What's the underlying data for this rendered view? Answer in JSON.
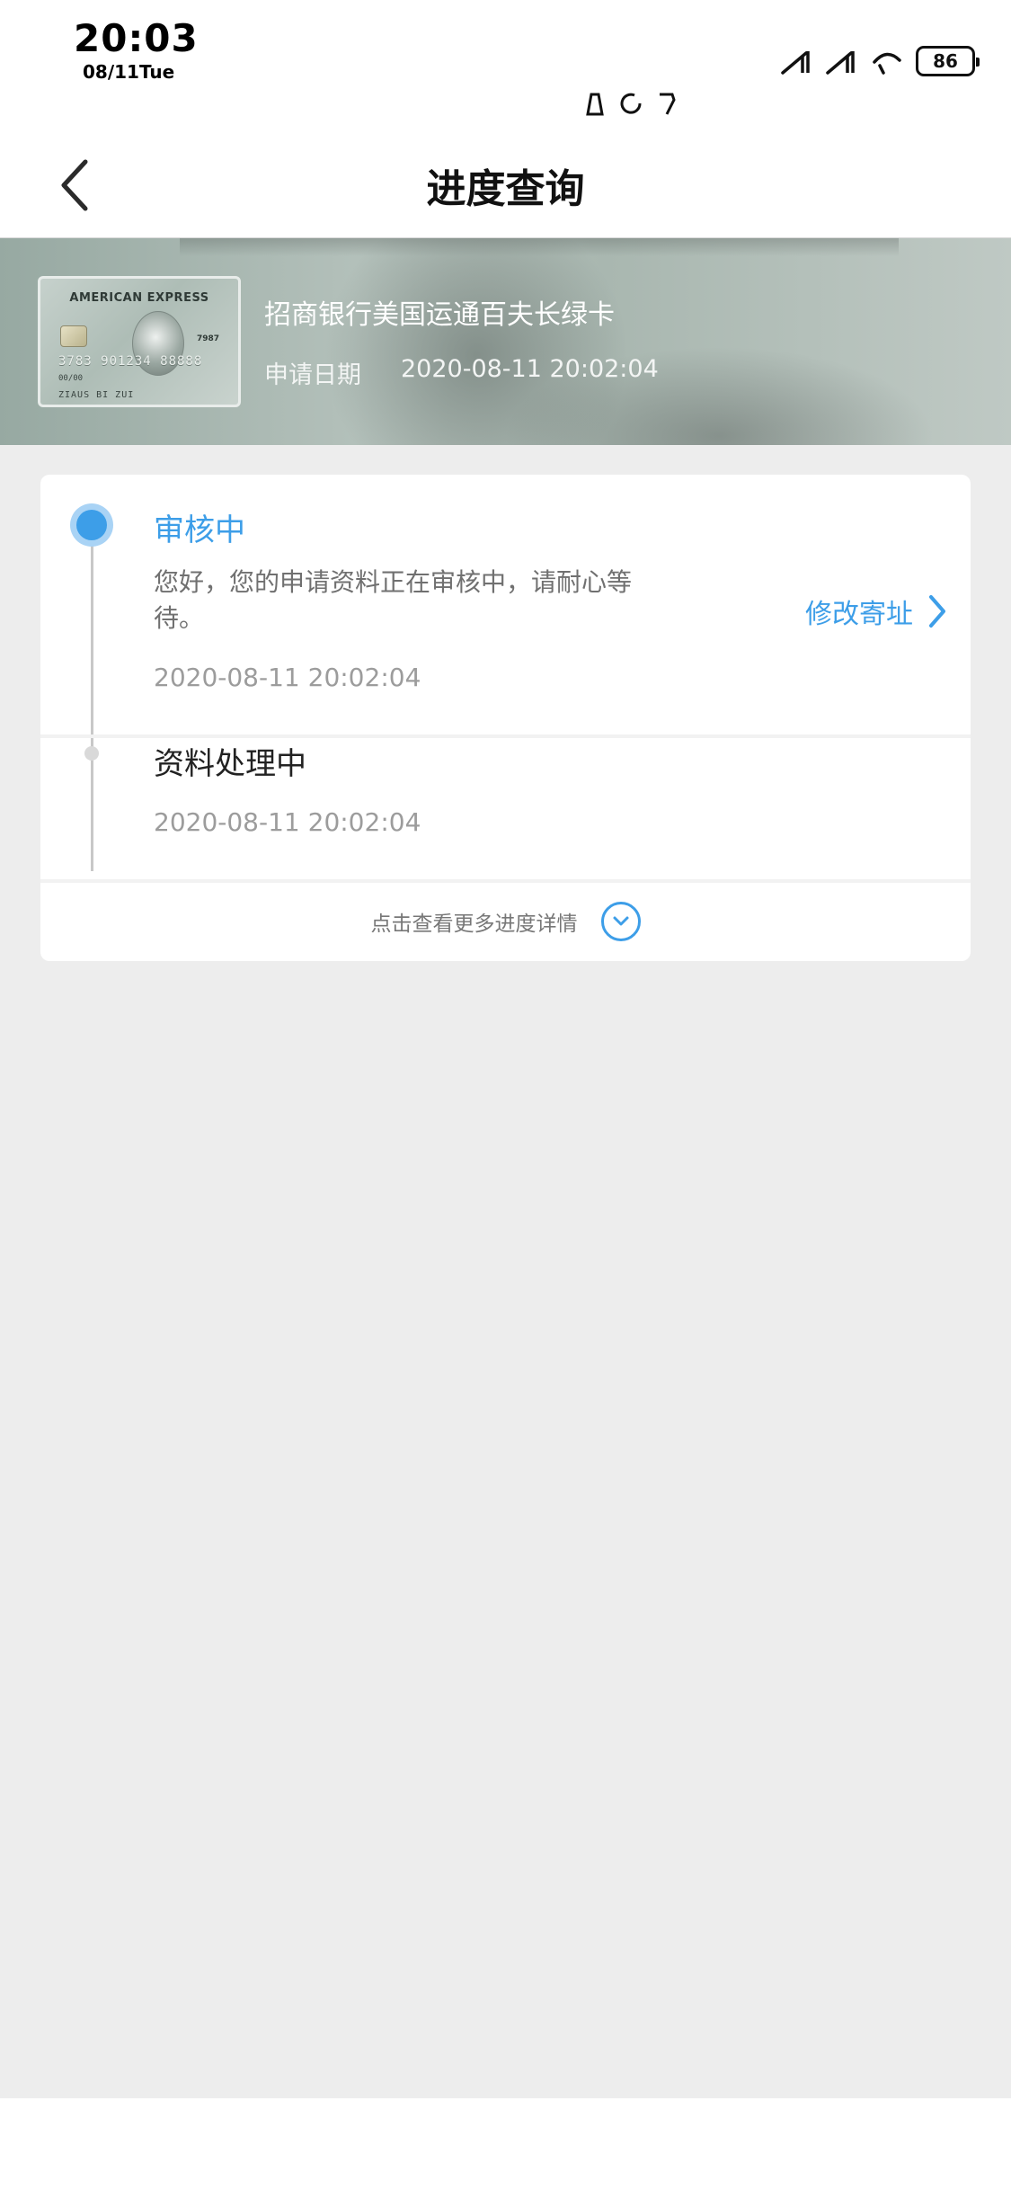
{
  "status_bar": {
    "time": "20:03",
    "date": "08/11Tue",
    "battery": "86",
    "icons": [
      "signal-1-icon",
      "signal-2-icon",
      "wifi-icon",
      "battery-icon"
    ],
    "notification_icons": [
      "notification-a-icon",
      "notification-b-icon",
      "notification-c-icon"
    ]
  },
  "nav": {
    "back_icon": "chevron-left-icon",
    "title": "进度查询"
  },
  "card": {
    "name": "招商银行美国运通百夫长绿卡",
    "date_label": "申请日期",
    "date_value": "2020-08-11 20:02:04",
    "thumb": {
      "brand": "AMERICAN EXPRESS",
      "number": "3783 901234 88888",
      "expiry": "00/00",
      "holder": "ZIAUS BI ZUI",
      "code": "7987"
    }
  },
  "progress": {
    "steps": [
      {
        "title": "审核中",
        "description": "您好，您的申请资料正在审核中，请耐心等待。",
        "time": "2020-08-11 20:02:04",
        "status": "active"
      },
      {
        "title": "资料处理中",
        "time": "2020-08-11 20:02:04",
        "status": "done"
      }
    ],
    "edit_address_label": "修改寄址",
    "more_label": "点击查看更多进度详情"
  },
  "colors": {
    "accent": "#3d9ee8",
    "background": "#ededed"
  }
}
